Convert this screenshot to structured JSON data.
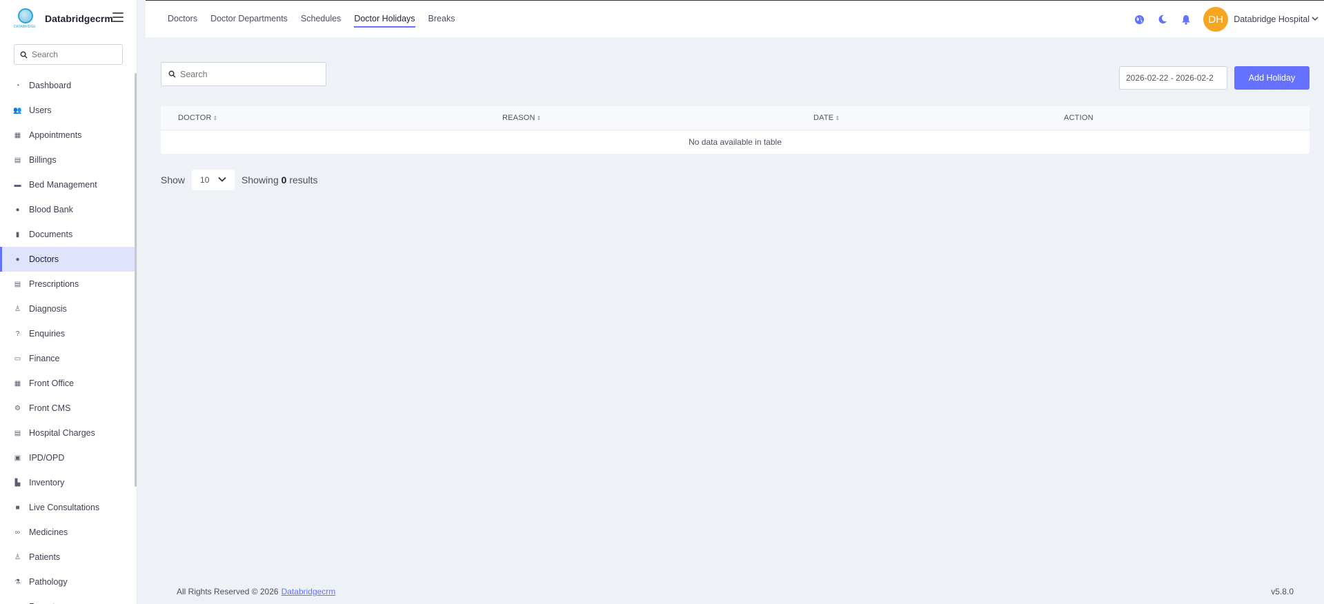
{
  "brand": {
    "name": "Databridgecrm",
    "logo_tag": "DATABRIDGE"
  },
  "sidebar": {
    "search_placeholder": "Search",
    "items": [
      {
        "label": "Dashboard",
        "icon": "dashboard-icon",
        "glyph": "◔"
      },
      {
        "label": "Users",
        "icon": "users-icon",
        "glyph": "👥"
      },
      {
        "label": "Appointments",
        "icon": "calendar-icon",
        "glyph": "▦"
      },
      {
        "label": "Billings",
        "icon": "file-invoice-icon",
        "glyph": "▤"
      },
      {
        "label": "Bed Management",
        "icon": "bed-icon",
        "glyph": "▬"
      },
      {
        "label": "Blood Bank",
        "icon": "drop-icon",
        "glyph": "●"
      },
      {
        "label": "Documents",
        "icon": "document-icon",
        "glyph": "▮"
      },
      {
        "label": "Doctors",
        "icon": "doctor-icon",
        "glyph": "●",
        "active": true
      },
      {
        "label": "Prescriptions",
        "icon": "prescription-icon",
        "glyph": "▤"
      },
      {
        "label": "Diagnosis",
        "icon": "diagnosis-icon",
        "glyph": "♙"
      },
      {
        "label": "Enquiries",
        "icon": "question-icon",
        "glyph": "?"
      },
      {
        "label": "Finance",
        "icon": "money-icon",
        "glyph": "▭"
      },
      {
        "label": "Front Office",
        "icon": "building-icon",
        "glyph": "▦"
      },
      {
        "label": "Front CMS",
        "icon": "gear-icon",
        "glyph": "⚙"
      },
      {
        "label": "Hospital Charges",
        "icon": "coins-icon",
        "glyph": "▤"
      },
      {
        "label": "IPD/OPD",
        "icon": "ipd-icon",
        "glyph": "▣"
      },
      {
        "label": "Inventory",
        "icon": "dolly-icon",
        "glyph": "▙"
      },
      {
        "label": "Live Consultations",
        "icon": "video-icon",
        "glyph": "■"
      },
      {
        "label": "Medicines",
        "icon": "capsules-icon",
        "glyph": "∞"
      },
      {
        "label": "Patients",
        "icon": "patient-icon",
        "glyph": "♙"
      },
      {
        "label": "Pathology",
        "icon": "flask-icon",
        "glyph": "⚗"
      },
      {
        "label": "Reports",
        "icon": "report-icon",
        "glyph": "▤"
      }
    ]
  },
  "topbar": {
    "tabs": [
      {
        "label": "Doctors",
        "active": false
      },
      {
        "label": "Doctor Departments",
        "active": false
      },
      {
        "label": "Schedules",
        "active": false
      },
      {
        "label": "Doctor Holidays",
        "active": true
      },
      {
        "label": "Breaks",
        "active": false
      }
    ],
    "avatar_initials": "DH",
    "user_name": "Databridge Hospital"
  },
  "main": {
    "search_placeholder": "Search",
    "date_range": "2026-02-22 - 2026-02-2",
    "add_button": "Add Holiday",
    "table": {
      "columns": [
        "DOCTOR",
        "REASON",
        "DATE",
        "ACTION"
      ],
      "empty_message": "No data available in table"
    },
    "pagination": {
      "show_label": "Show",
      "page_size": "10",
      "showing_prefix": "Showing",
      "count": "0",
      "showing_suffix": "results"
    }
  },
  "footer": {
    "copyright": "All Rights Reserved © 2026",
    "link": "Databridgecrm",
    "version": "v5.8.0"
  },
  "colors": {
    "accent": "#6571ff",
    "avatar": "#f5a623",
    "active_bg": "#dfe3fb",
    "page_bg": "#eef1f6"
  }
}
